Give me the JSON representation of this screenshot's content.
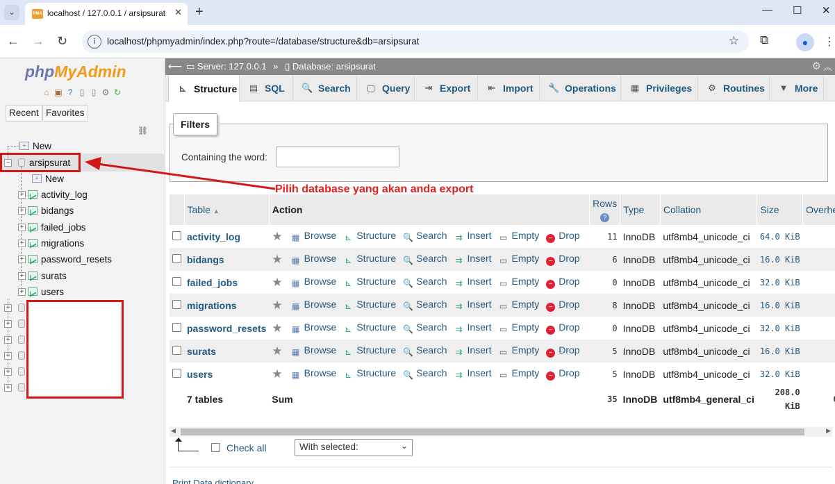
{
  "browser": {
    "tab_title": "localhost / 127.0.0.1 / arsipsurat",
    "url": "localhost/phpmyadmin/index.php?route=/database/structure&db=arsipsurat"
  },
  "nav": {
    "logo_php": "php",
    "logo_myadmin": "MyAdmin",
    "tabs": [
      "Recent",
      "Favorites"
    ],
    "tree": {
      "new_root": "New",
      "database": "arsipsurat",
      "new_table": "New",
      "tables": [
        "activity_log",
        "bidangs",
        "failed_jobs",
        "migrations",
        "password_resets",
        "surats",
        "users"
      ]
    }
  },
  "server_bar": {
    "server": "Server: 127.0.0.1",
    "separator": "»",
    "database": "Database: arsipsurat"
  },
  "menu": [
    {
      "label": "Structure",
      "icon": "structure-icon"
    },
    {
      "label": "SQL",
      "icon": "sql-icon"
    },
    {
      "label": "Search",
      "icon": "search-icon"
    },
    {
      "label": "Query",
      "icon": "query-icon"
    },
    {
      "label": "Export",
      "icon": "export-icon"
    },
    {
      "label": "Import",
      "icon": "import-icon"
    },
    {
      "label": "Operations",
      "icon": "wrench-icon"
    },
    {
      "label": "Privileges",
      "icon": "privileges-icon"
    },
    {
      "label": "Routines",
      "icon": "routines-icon"
    },
    {
      "label": "More",
      "icon": "caret-down-icon"
    }
  ],
  "filters": {
    "legend": "Filters",
    "label": "Containing the word:",
    "value": ""
  },
  "annotation": "Pilih database yang akan anda export",
  "table": {
    "headers": {
      "table": "Table",
      "action": "Action",
      "rows": "Rows",
      "type": "Type",
      "collation": "Collation",
      "size": "Size",
      "overhead": "Overhe"
    },
    "actions": [
      "Browse",
      "Structure",
      "Search",
      "Insert",
      "Empty",
      "Drop"
    ],
    "rows": [
      {
        "name": "activity_log",
        "rows": "11",
        "type": "InnoDB",
        "collation": "utf8mb4_unicode_ci",
        "size": "64.0 KiB"
      },
      {
        "name": "bidangs",
        "rows": "6",
        "type": "InnoDB",
        "collation": "utf8mb4_unicode_ci",
        "size": "16.0 KiB"
      },
      {
        "name": "failed_jobs",
        "rows": "0",
        "type": "InnoDB",
        "collation": "utf8mb4_unicode_ci",
        "size": "32.0 KiB"
      },
      {
        "name": "migrations",
        "rows": "8",
        "type": "InnoDB",
        "collation": "utf8mb4_unicode_ci",
        "size": "16.0 KiB"
      },
      {
        "name": "password_resets",
        "rows": "0",
        "type": "InnoDB",
        "collation": "utf8mb4_unicode_ci",
        "size": "32.0 KiB"
      },
      {
        "name": "surats",
        "rows": "5",
        "type": "InnoDB",
        "collation": "utf8mb4_unicode_ci",
        "size": "16.0 KiB"
      },
      {
        "name": "users",
        "rows": "5",
        "type": "InnoDB",
        "collation": "utf8mb4_unicode_ci",
        "size": "32.0 KiB"
      }
    ],
    "summary": {
      "count": "7 tables",
      "label": "Sum",
      "rows": "35",
      "type": "InnoDB",
      "collation": "utf8mb4_general_ci",
      "size_1": "208.0",
      "size_2": "KiB",
      "overhead": "0"
    }
  },
  "footer": {
    "check_all": "Check all",
    "with_selected": "With selected:",
    "bottom_links": "Print   Data dictionary"
  },
  "colors": {
    "annotation_red": "#d01818",
    "link_blue": "#235a81",
    "logo_php": "#6c78af",
    "logo_myadmin": "#f29b17"
  }
}
